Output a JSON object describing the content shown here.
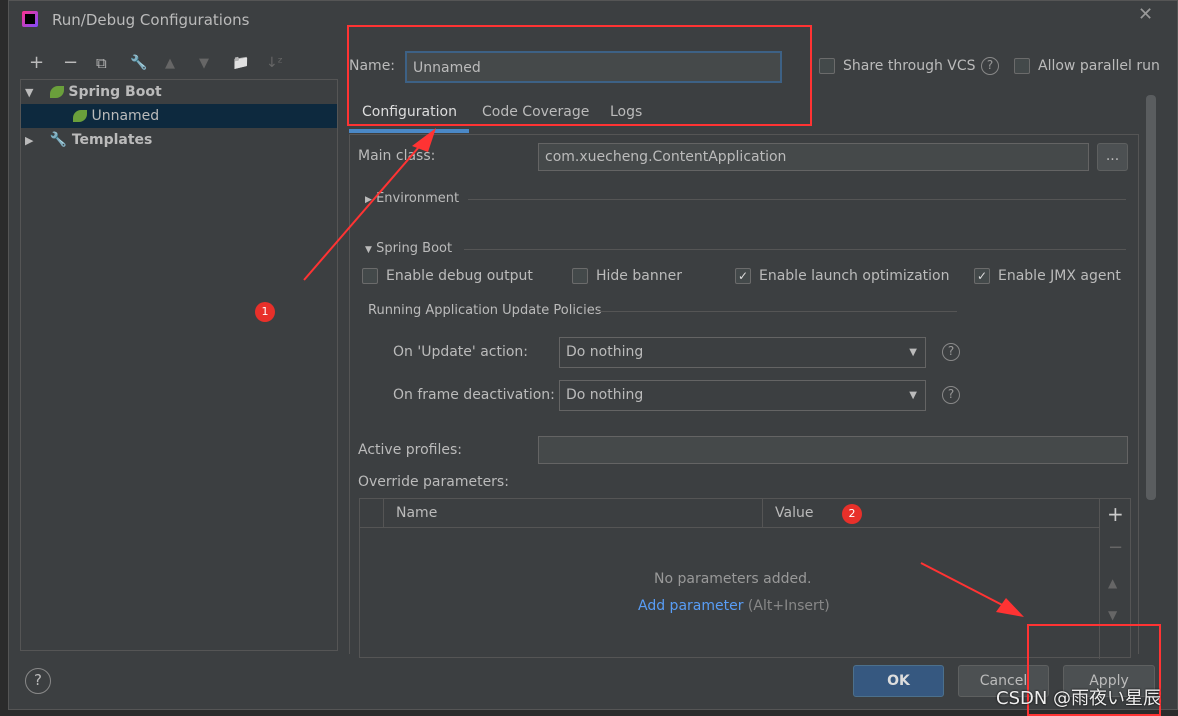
{
  "window": {
    "title": "Run/Debug Configurations",
    "close": "✕"
  },
  "toolbar": {
    "add": "+",
    "remove": "−",
    "copy": "⧉",
    "edit": "🔧",
    "up": "▲",
    "down": "▼",
    "folder": "📁",
    "sort": "↓ᶻ"
  },
  "tree": {
    "items": [
      {
        "label": "Spring Boot",
        "arrow": "▼"
      },
      {
        "label": "Unnamed"
      },
      {
        "label": "Templates",
        "arrow": "▶"
      }
    ]
  },
  "name": {
    "label": "Name:",
    "value": "Unnamed"
  },
  "share_vcs": {
    "label": "Share through VCS",
    "checked": false
  },
  "parallel": {
    "label": "Allow parallel run",
    "checked": false
  },
  "tabs": [
    {
      "label": "Configuration",
      "active": true
    },
    {
      "label": "Code Coverage"
    },
    {
      "label": "Logs"
    }
  ],
  "main_class": {
    "label": "Main class:",
    "value": "com.xuecheng.ContentApplication",
    "browse": "..."
  },
  "environment": {
    "label": "Environment"
  },
  "spring_boot": {
    "label": "Spring Boot",
    "options": [
      {
        "label": "Enable debug output",
        "checked": false
      },
      {
        "label": "Hide banner",
        "checked": false
      },
      {
        "label": "Enable launch optimization",
        "checked": true
      },
      {
        "label": "Enable JMX agent",
        "checked": true
      }
    ]
  },
  "policies": {
    "label": "Running Application Update Policies",
    "update": {
      "label": "On 'Update' action:",
      "value": "Do nothing"
    },
    "frame": {
      "label": "On frame deactivation:",
      "value": "Do nothing"
    }
  },
  "active_profiles": {
    "label": "Active profiles:",
    "value": ""
  },
  "override": {
    "label": "Override parameters:",
    "columns": [
      "Name",
      "Value"
    ],
    "empty": "No parameters added.",
    "add_link": "Add parameter",
    "add_hint": "(Alt+Insert)"
  },
  "side_buttons": {
    "add": "+",
    "remove": "−",
    "up": "▲",
    "down": "▼"
  },
  "annotations": {
    "one": "1",
    "two": "2"
  },
  "buttons": {
    "help": "?",
    "ok": "OK",
    "cancel": "Cancel",
    "apply": "Apply"
  },
  "watermark": "CSDN @雨夜い星辰"
}
